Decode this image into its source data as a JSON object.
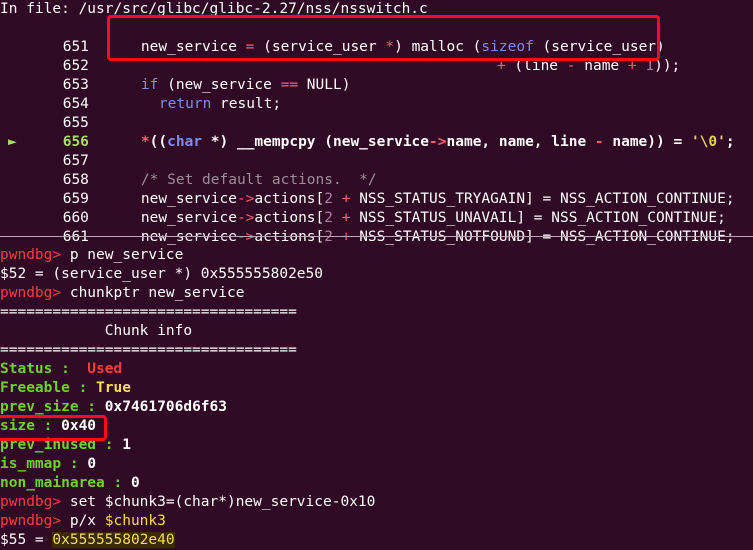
{
  "header": {
    "file_label": "In file: /usr/src/glibc/glibc-2.27/nss/nsswitch.c"
  },
  "source": {
    "lines": [
      {
        "num": "651",
        "current": false
      },
      {
        "num": "652",
        "current": false
      },
      {
        "num": "653",
        "current": false
      },
      {
        "num": "654",
        "current": false
      },
      {
        "num": "655",
        "current": false
      },
      {
        "num": "656",
        "current": true,
        "marker": "►"
      },
      {
        "num": "657",
        "current": false
      },
      {
        "num": "658",
        "current": false
      },
      {
        "num": "659",
        "current": false
      },
      {
        "num": "660",
        "current": false
      },
      {
        "num": "661",
        "current": false
      }
    ],
    "tokens": {
      "l651": [
        "new_service",
        " = ",
        "(service_user ",
        "*",
        ") malloc (",
        "sizeof",
        " (service_user)"
      ],
      "l652": [
        "+",
        " (line ",
        "-",
        " name ",
        "+",
        " ",
        "1",
        "));"
      ],
      "l653": [
        "if",
        " (new_service ",
        "==",
        " NULL)"
      ],
      "l654": [
        "return",
        " result;"
      ],
      "l656": [
        "*",
        "((",
        "char",
        " *) __mempcpy (new_service",
        "->",
        "name, name, line ",
        "-",
        " name)) = ",
        "'\\0'",
        ";"
      ],
      "l658": [
        "/* Set default actions.  */"
      ],
      "l659": [
        "new_service",
        "->",
        "actions[",
        "2",
        " ",
        "+",
        " NSS_STATUS_TRYAGAIN] = NSS_ACTION_CONTINUE;"
      ],
      "l660": [
        "new_service",
        "->",
        "actions[",
        "2",
        " ",
        "+",
        " NSS_STATUS_UNAVAIL] = NSS_ACTION_CONTINUE;"
      ],
      "l661": [
        "new_service",
        "->",
        "actions[",
        "2",
        " ",
        "+",
        " NSS_STATUS_NOTFOUND] = NSS_ACTION_CONTINUE;"
      ]
    }
  },
  "console": {
    "prompt": "pwndbg>",
    "cmd1": " p new_service",
    "out1": "$52 = (service_user *) 0x555555802e50",
    "cmd2": " chunkptr new_service",
    "rule": "==================================",
    "title": "            Chunk info",
    "status_key": "Status : ",
    "status_val": " Used",
    "freeable_key": "Freeable : ",
    "freeable_val": "True",
    "prev_size_key": "prev_size : ",
    "prev_size_val": "0x7461706d6f63",
    "size_key": "size : ",
    "size_val": "0x40",
    "prev_inused_key": "prev_inused : ",
    "prev_inused_val": "1",
    "is_mmap_key": "is_mmap : ",
    "is_mmap_val": "0",
    "non_mainarea_key": "non_mainarea : ",
    "non_mainarea_val": "0",
    "cmd3": " set $chunk3=(char*)new_service-0x10",
    "cmd4_a": " p/x ",
    "cmd4_b": "$chunk3",
    "out4_a": "$55 = ",
    "out4_b": "0x555555802e40"
  },
  "colors": {
    "background": "#300a24",
    "highlight_box": "#ff0a17",
    "keyword": "#7e8df2",
    "operator": "#ff5f6b",
    "number": "#ad7fa8",
    "status_key": "#6ed22a",
    "status_used": "#ff3c3c",
    "value_yellow": "#f7df4f"
  }
}
